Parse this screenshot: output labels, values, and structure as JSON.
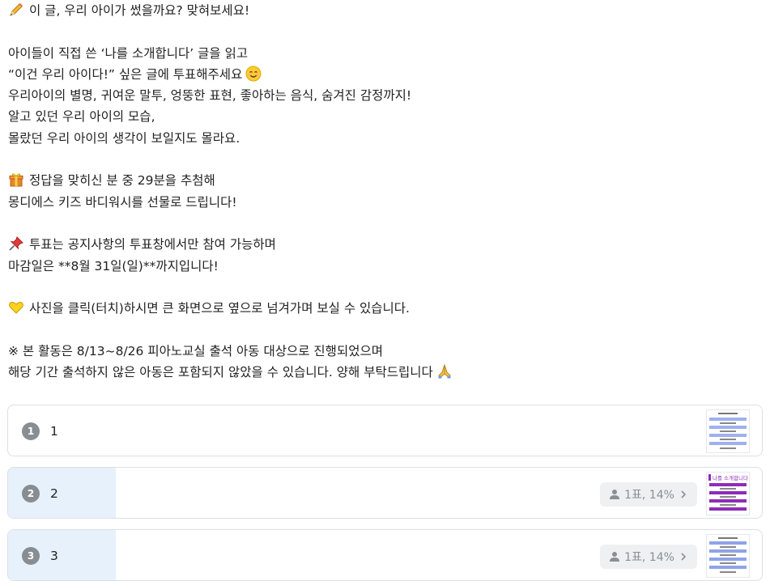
{
  "post": {
    "lines": [
      {
        "icon": "pencil-icon",
        "text": "이 글, 우리 아이가 썼을까요? 맞혀보세요!"
      },
      {
        "text": ""
      },
      {
        "text": "아이들이 직접 쓴 ‘나를 소개합니다’ 글을 읽고"
      },
      {
        "text": "“이건 우리 아이다!” 싶은 글에 투표해주세요",
        "icon_after": "smiling-face-icon"
      },
      {
        "text": "우리아이의 별명, 귀여운 말투, 엉뚱한 표현, 좋아하는 음식, 숨겨진 감정까지!"
      },
      {
        "text": "알고 있던 우리 아이의 모습,"
      },
      {
        "text": "몰랐던 우리 아이의 생각이 보일지도 몰라요."
      },
      {
        "text": ""
      },
      {
        "icon": "gift-icon",
        "text": "정답을 맞히신 분 중 29분을 추첨해"
      },
      {
        "text": "몽디에스 키즈 바디워시를 선물로 드립니다!"
      },
      {
        "text": ""
      },
      {
        "icon": "pushpin-icon",
        "text": "투표는 공지사항의 투표창에서만 참여 가능하며"
      },
      {
        "text": "마감일은 **8월 31일(일)**까지입니다!"
      },
      {
        "text": ""
      },
      {
        "icon": "yellow-heart-icon",
        "text": "사진을 클릭(터치)하시면 큰 화면으로 옆으로 넘겨가며 보실 수 있습니다."
      },
      {
        "text": ""
      },
      {
        "text": "※ 본 활동은 8/13~8/26 피아노교실 출석 아동 대상으로 진행되었으며"
      },
      {
        "text": "해당 기간 출석하지 않은 아동은 포함되지 않았을 수 있습니다. 양해 부탁드립니다",
        "icon_after": "folded-hands-icon"
      }
    ]
  },
  "poll": {
    "options": [
      {
        "number": "1",
        "label": "1",
        "votes_text": "",
        "share": 0,
        "thumb_theme": "blue"
      },
      {
        "number": "2",
        "label": "2",
        "votes_text": "1표, 14%",
        "share": 0.14,
        "thumb_theme": "purple",
        "thumb_title": "나를 소개합니다"
      },
      {
        "number": "3",
        "label": "3",
        "votes_text": "1표, 14%",
        "share": 0.14,
        "thumb_theme": "blue"
      }
    ]
  },
  "colors": {
    "fill": "#e6f1fc",
    "badge": "#888d94",
    "blue_band": "#8fa3e8",
    "purple_band": "#8e2cb8"
  }
}
